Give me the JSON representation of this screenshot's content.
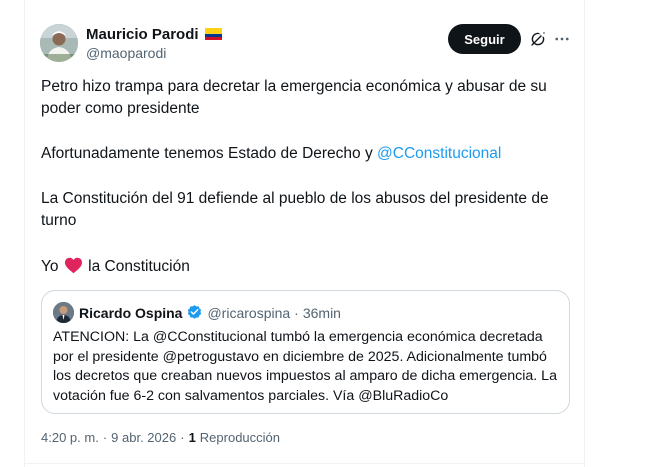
{
  "author": {
    "name": "Mauricio Parodi",
    "handle": "@maoparodi",
    "flag_icon": "colombia-flag-icon"
  },
  "actions": {
    "follow_label": "Seguir",
    "grok_icon": "grok-icon",
    "more_icon": "more-options-icon"
  },
  "tweet": {
    "paragraph_1": "Petro hizo trampa para decretar la emergencia económica y abusar de su poder como presidente",
    "paragraph_2_text": "Afortunadamente tenemos Estado de Derecho y ",
    "paragraph_2_mention": "@CConstitucional",
    "paragraph_3": "La Constitución del 91 defiende al pueblo de los abusos del presidente de turno",
    "paragraph_4_before": "Yo",
    "paragraph_4_after": "la Constitución"
  },
  "quote": {
    "name": "Ricardo Ospina",
    "handle": "@ricarospina",
    "separator": "·",
    "time": "36min",
    "text": "ATENCION: La @CConstitucional tumbó la emergencia económica decretada por el presidente @petrogustavo en diciembre de 2025. Adicionalmente tumbó los decretos que creaban nuevos impuestos al amparo de dicha emergencia. La votación fue 6-2 con salvamentos parciales. Vía @BluRadioCo"
  },
  "meta": {
    "time": "4:20 p. m.",
    "separator": "·",
    "date": "9 abr. 2026",
    "views_separator": "·",
    "views_count": "1",
    "views_label": "Reproducción"
  },
  "colors": {
    "text": "#0f1419",
    "secondary": "#536471",
    "link": "#1d9bf0",
    "border": "#cfd9de",
    "heart": "#f91880",
    "verified": "#1d9bf0"
  }
}
